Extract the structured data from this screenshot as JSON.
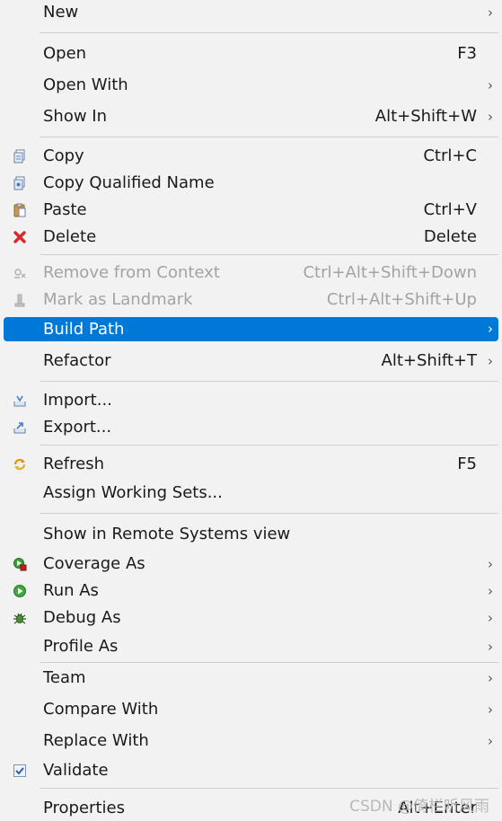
{
  "menu": {
    "items": [
      {
        "label": "New",
        "accel": "",
        "arrow": "›"
      },
      {
        "label": "Open",
        "accel": "F3",
        "arrow": ""
      },
      {
        "label": "Open With",
        "accel": "",
        "arrow": "›"
      },
      {
        "label": "Show In",
        "accel": "Alt+Shift+W",
        "arrow": "›"
      },
      {
        "label": "Copy",
        "accel": "Ctrl+C",
        "arrow": "",
        "icon": "copy-icon"
      },
      {
        "label": "Copy Qualified Name",
        "accel": "",
        "arrow": "",
        "icon": "copy-qualified-name-icon"
      },
      {
        "label": "Paste",
        "accel": "Ctrl+V",
        "arrow": "",
        "icon": "paste-icon"
      },
      {
        "label": "Delete",
        "accel": "Delete",
        "arrow": "",
        "icon": "delete-icon"
      },
      {
        "label": "Remove from Context",
        "accel": "Ctrl+Alt+Shift+Down",
        "arrow": "",
        "icon": "remove-context-icon",
        "disabled": true
      },
      {
        "label": "Mark as Landmark",
        "accel": "Ctrl+Alt+Shift+Up",
        "arrow": "",
        "icon": "landmark-icon",
        "disabled": true
      },
      {
        "label": "Build Path",
        "accel": "",
        "arrow": "›",
        "selected": true
      },
      {
        "label": "Refactor",
        "accel": "Alt+Shift+T",
        "arrow": "›"
      },
      {
        "label": "Import...",
        "accel": "",
        "arrow": "",
        "icon": "import-icon"
      },
      {
        "label": "Export...",
        "accel": "",
        "arrow": "",
        "icon": "export-icon"
      },
      {
        "label": "Refresh",
        "accel": "F5",
        "arrow": "",
        "icon": "refresh-icon"
      },
      {
        "label": "Assign Working Sets...",
        "accel": "",
        "arrow": ""
      },
      {
        "label": "Show in Remote Systems view",
        "accel": "",
        "arrow": ""
      },
      {
        "label": "Coverage As",
        "accel": "",
        "arrow": "›",
        "icon": "coverage-icon"
      },
      {
        "label": "Run As",
        "accel": "",
        "arrow": "›",
        "icon": "run-icon"
      },
      {
        "label": "Debug As",
        "accel": "",
        "arrow": "›",
        "icon": "debug-icon"
      },
      {
        "label": "Profile As",
        "accel": "",
        "arrow": "›"
      },
      {
        "label": "Team",
        "accel": "",
        "arrow": "›"
      },
      {
        "label": "Compare With",
        "accel": "",
        "arrow": "›"
      },
      {
        "label": "Replace With",
        "accel": "",
        "arrow": "›"
      },
      {
        "label": "Validate",
        "accel": "",
        "arrow": "",
        "icon": "validate-check-icon"
      },
      {
        "label": "Properties",
        "accel": "Alt+Enter",
        "arrow": ""
      }
    ]
  },
  "watermark": "CSDN @倚栏听风雨",
  "colors": {
    "menu_bg": "#f2f2f2",
    "selection": "#0078d7",
    "disabled_text": "#a3a3a3",
    "separator": "#cfcfcf"
  }
}
